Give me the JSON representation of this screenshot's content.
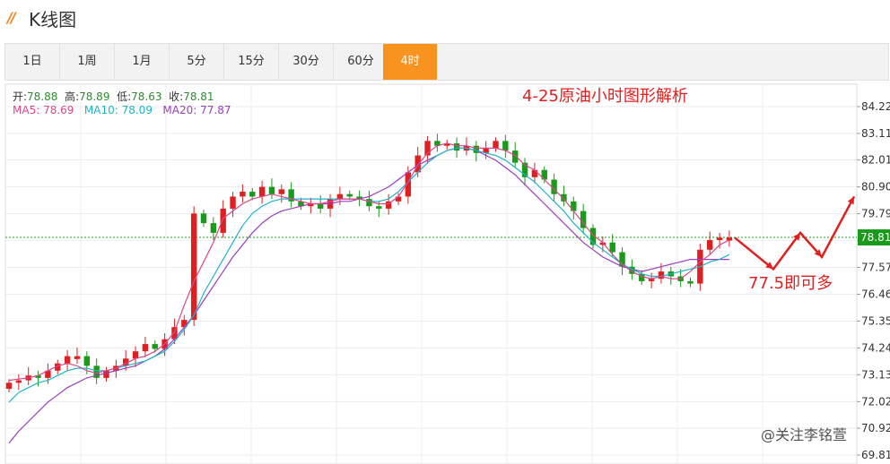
{
  "header": {
    "title": "K线图",
    "logo_icon": "orange-slash-logo-icon"
  },
  "tabs": [
    "1日",
    "1周",
    "1月",
    "5分",
    "15分",
    "30分",
    "60分",
    "4时"
  ],
  "active_tab": "4时",
  "ohlc": {
    "open_label": "开:",
    "open": "78.88",
    "high_label": "高:",
    "high": "78.89",
    "low_label": "低:",
    "low": "78.63",
    "close_label": "收:",
    "close": "78.81"
  },
  "ma": {
    "ma5_label": "MA5:",
    "ma5": "78.69",
    "ma5_color": "#d9488b",
    "ma10_label": "MA10:",
    "ma10": "78.09",
    "ma10_color": "#1fb3c8",
    "ma20_label": "MA20:",
    "ma20": "77.87",
    "ma20_color": "#9b3dbd"
  },
  "annotations": {
    "title": "4-25原油小时图形解析",
    "target": "77.5即可多",
    "watermark": "@关注李铭萱"
  },
  "colors": {
    "up": "#e02020",
    "down": "#1a9a1a",
    "accent": "#f7931e",
    "text_red": "#e02020"
  },
  "chart_data": {
    "type": "candlestick",
    "y_ticks": [
      "84.22",
      "83.11",
      "82.01",
      "80.90",
      "79.79",
      "78.69",
      "77.57",
      "76.46",
      "75.35",
      "74.24",
      "73.13",
      "72.02",
      "70.92",
      "69.81"
    ],
    "current_price": "78.81",
    "ylim": [
      69.81,
      84.22
    ],
    "closes": [
      72.8,
      72.9,
      73.1,
      73.0,
      73.3,
      73.6,
      73.9,
      73.9,
      73.5,
      73.0,
      73.3,
      73.5,
      73.8,
      74.1,
      74.4,
      74.2,
      74.6,
      75.1,
      75.4,
      79.8,
      79.4,
      79.0,
      80.0,
      80.5,
      80.7,
      80.5,
      80.9,
      80.6,
      80.8,
      80.3,
      80.1,
      80.2,
      80.0,
      80.4,
      80.6,
      80.5,
      80.4,
      80.1,
      80.0,
      80.3,
      80.5,
      81.5,
      82.2,
      82.8,
      82.6,
      82.7,
      82.4,
      82.6,
      82.3,
      82.5,
      82.8,
      82.4,
      81.9,
      81.3,
      81.6,
      81.2,
      80.6,
      80.3,
      79.9,
      79.2,
      78.5,
      78.6,
      78.2,
      77.6,
      77.3,
      77.0,
      77.1,
      77.4,
      77.2,
      77.0,
      76.9,
      78.3,
      78.7,
      78.8,
      78.8
    ],
    "ma5": [
      72.9,
      72.95,
      73.0,
      73.1,
      73.3,
      73.5,
      73.6,
      73.5,
      73.3,
      73.2,
      73.3,
      73.4,
      73.6,
      73.8,
      73.9,
      74.1,
      74.4,
      74.9,
      76.0,
      77.0,
      77.8,
      78.6,
      79.6,
      79.9,
      80.2,
      80.4,
      80.5,
      80.6,
      80.5,
      80.4,
      80.3,
      80.2,
      80.2,
      80.3,
      80.4,
      80.4,
      80.4,
      80.3,
      80.2,
      80.2,
      80.5,
      81.1,
      81.8,
      82.3,
      82.6,
      82.7,
      82.6,
      82.6,
      82.5,
      82.5,
      82.5,
      82.4,
      82.2,
      81.8,
      81.6,
      81.2,
      80.8,
      80.4,
      79.9,
      79.4,
      78.9,
      78.6,
      78.1,
      77.7,
      77.4,
      77.2,
      77.1,
      77.2,
      77.1,
      77.1,
      77.4,
      77.8,
      78.1,
      78.5,
      78.7
    ],
    "ma10": [
      72.0,
      72.4,
      72.6,
      72.8,
      72.9,
      73.1,
      73.3,
      73.4,
      73.4,
      73.3,
      73.3,
      73.4,
      73.5,
      73.6,
      73.7,
      73.9,
      74.1,
      74.5,
      75.0,
      75.6,
      76.5,
      77.2,
      77.9,
      78.6,
      79.3,
      79.8,
      80.1,
      80.3,
      80.4,
      80.4,
      80.4,
      80.4,
      80.4,
      80.4,
      80.4,
      80.4,
      80.4,
      80.3,
      80.3,
      80.4,
      80.7,
      81.1,
      81.5,
      81.9,
      82.2,
      82.4,
      82.5,
      82.5,
      82.4,
      82.3,
      82.2,
      82.0,
      81.7,
      81.4,
      81.1,
      80.7,
      80.3,
      79.9,
      79.4,
      79.0,
      78.6,
      78.3,
      78.0,
      77.7,
      77.5,
      77.3,
      77.2,
      77.2,
      77.3,
      77.4,
      77.5,
      77.6,
      77.8,
      77.9,
      78.1
    ],
    "ma20": [
      70.3,
      70.8,
      71.2,
      71.6,
      72.0,
      72.3,
      72.6,
      72.8,
      73.0,
      73.1,
      73.2,
      73.3,
      73.4,
      73.5,
      73.7,
      73.9,
      74.2,
      74.6,
      75.1,
      75.6,
      76.2,
      76.8,
      77.4,
      78.0,
      78.5,
      79.0,
      79.4,
      79.7,
      79.9,
      80.0,
      80.1,
      80.2,
      80.2,
      80.2,
      80.3,
      80.3,
      80.4,
      80.5,
      80.7,
      80.9,
      81.2,
      81.5,
      81.8,
      82.0,
      82.2,
      82.4,
      82.5,
      82.5,
      82.4,
      82.2,
      82.0,
      81.7,
      81.4,
      81.0,
      80.6,
      80.2,
      79.8,
      79.4,
      79.0,
      78.6,
      78.3,
      78.0,
      77.8,
      77.6,
      77.5,
      77.4,
      77.5,
      77.6,
      77.7,
      77.8,
      77.9,
      77.9,
      77.9,
      77.9,
      77.9
    ],
    "projection": [
      78.8,
      77.5,
      79.0,
      78.0,
      80.5
    ]
  }
}
